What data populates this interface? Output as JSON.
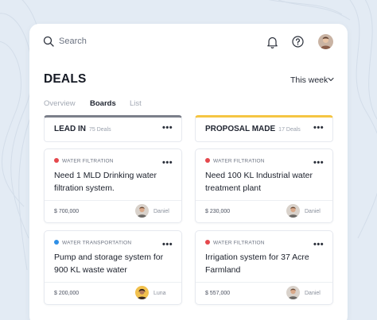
{
  "search": {
    "placeholder": "Search"
  },
  "header": {
    "title": "DEALS",
    "period": "This week"
  },
  "tabs": [
    {
      "label": "Overview",
      "active": false
    },
    {
      "label": "Boards",
      "active": true
    },
    {
      "label": "List",
      "active": false
    }
  ],
  "columns": [
    {
      "name": "LEAD IN",
      "count": "75 Deals",
      "accent": "#7b7f8a",
      "cards": [
        {
          "category": "WATER FILTRATION",
          "category_color": "#e5484d",
          "title": "Need 1 MLD Drinking water filtration system.",
          "amount": "$ 700,000",
          "owner": "Daniel"
        },
        {
          "category": "WATER TRANSPORTATION",
          "category_color": "#2f8fe6",
          "title": "Pump and storage system for 900 KL waste water",
          "amount": "$ 200,000",
          "owner": "Luna"
        }
      ]
    },
    {
      "name": "PROPOSAL MADE",
      "count": "17 Deals",
      "accent": "#f5c542",
      "cards": [
        {
          "category": "WATER FILTRATION",
          "category_color": "#e5484d",
          "title": "Need 100 KL Industrial water treatment plant",
          "amount": "$ 230,000",
          "owner": "Daniel"
        },
        {
          "category": "WATER FILTRATION",
          "category_color": "#e5484d",
          "title": "Irrigation system for 37 Acre Farmland",
          "amount": "$ 557,000",
          "owner": "Daniel"
        }
      ]
    }
  ],
  "icons": {
    "search": "search-icon",
    "notifications": "bell-icon",
    "help": "question-circle-icon",
    "more": "more-horizontal-icon",
    "dropdown": "chevron-down-icon"
  }
}
